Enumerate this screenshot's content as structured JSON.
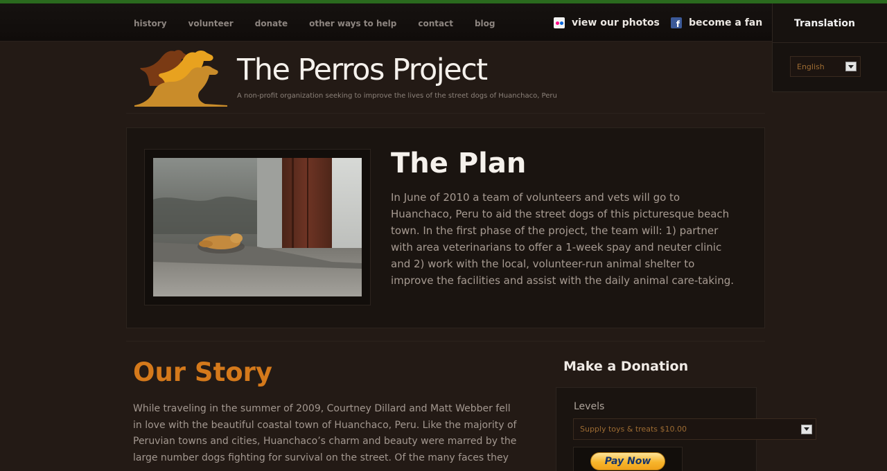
{
  "nav": {
    "items": [
      "history",
      "volunteer",
      "donate",
      "other ways to help",
      "contact",
      "blog"
    ]
  },
  "social": {
    "photos_label": "view our photos",
    "photos_icon": "flickr-icon",
    "fan_label": "become a fan",
    "fan_icon": "facebook-icon"
  },
  "translation": {
    "title": "Translation",
    "selected_language": "English"
  },
  "header": {
    "site_title": "The Perros Project",
    "tagline": "A non-profit organization seeking to improve the lives of the street dogs of Huanchaco, Peru",
    "logo_icon": "dogs-logo-icon"
  },
  "plan": {
    "title": "The Plan",
    "text": "In June of 2010 a team of volunteers and vets will go to Huanchaco, Peru to aid the street dogs of this picturesque beach town. In the first phase of the project, the team will: 1) partner with area veterinarians to offer a 1-week spay and neuter clinic and 2) work with the local, volunteer-run animal shelter to improve the facilities and assist with the daily animal care-taking."
  },
  "story": {
    "title": "Our Story",
    "text": "While traveling in the summer of 2009, Courtney Dillard and Matt Webber fell in love with the beautiful coastal town of Huanchaco, Peru. Like the majority of Peruvian towns and cities, Huanchaco’s charm and beauty were marred by the large number dogs fighting for survival on the street. Of the many faces they saw"
  },
  "donation": {
    "title": "Make a Donation",
    "levels_label": "Levels",
    "selected_level": "Supply toys & treats $10.00",
    "pay_button": "Pay Now"
  },
  "colors": {
    "accent_orange": "#d4791b",
    "top_stripe_green": "#2a6a1e",
    "background": "#231a15"
  }
}
